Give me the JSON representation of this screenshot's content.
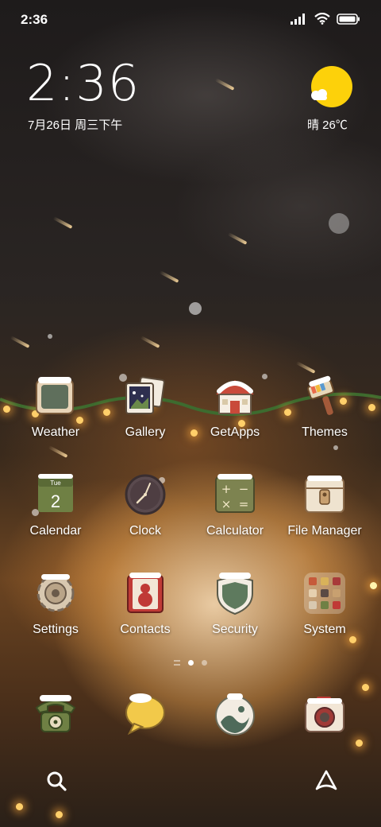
{
  "status_bar": {
    "time": "2:36",
    "icons": [
      "signal-icon",
      "wifi-icon",
      "battery-icon"
    ]
  },
  "clock_widget": {
    "time": "2:36",
    "date": "7月26日 周三下午"
  },
  "weather_widget": {
    "condition_temp": "晴 26℃",
    "icon": "sunny-icon",
    "sun_color": "#fdd10a"
  },
  "apps": [
    {
      "label": "Weather",
      "icon": "weather-app-icon"
    },
    {
      "label": "Gallery",
      "icon": "gallery-app-icon"
    },
    {
      "label": "GetApps",
      "icon": "getapps-app-icon"
    },
    {
      "label": "Themes",
      "icon": "themes-app-icon"
    },
    {
      "label": "Calendar",
      "icon": "calendar-app-icon",
      "badge_day": "Tue",
      "badge_date": "2"
    },
    {
      "label": "Clock",
      "icon": "clock-app-icon"
    },
    {
      "label": "Calculator",
      "icon": "calculator-app-icon"
    },
    {
      "label": "File Manager",
      "icon": "file-manager-app-icon"
    },
    {
      "label": "Settings",
      "icon": "settings-app-icon"
    },
    {
      "label": "Contacts",
      "icon": "contacts-app-icon"
    },
    {
      "label": "Security",
      "icon": "security-app-icon"
    },
    {
      "label": "System",
      "icon": "system-folder-icon"
    }
  ],
  "dock": [
    {
      "icon": "phone-app-icon"
    },
    {
      "icon": "messages-app-icon"
    },
    {
      "icon": "browser-app-icon"
    },
    {
      "icon": "camera-app-icon"
    }
  ],
  "page_indicator": {
    "pages": 2,
    "current": 1
  },
  "bottom_bar": {
    "left_icon": "search-icon",
    "right_icon": "app-launcher-icon"
  }
}
